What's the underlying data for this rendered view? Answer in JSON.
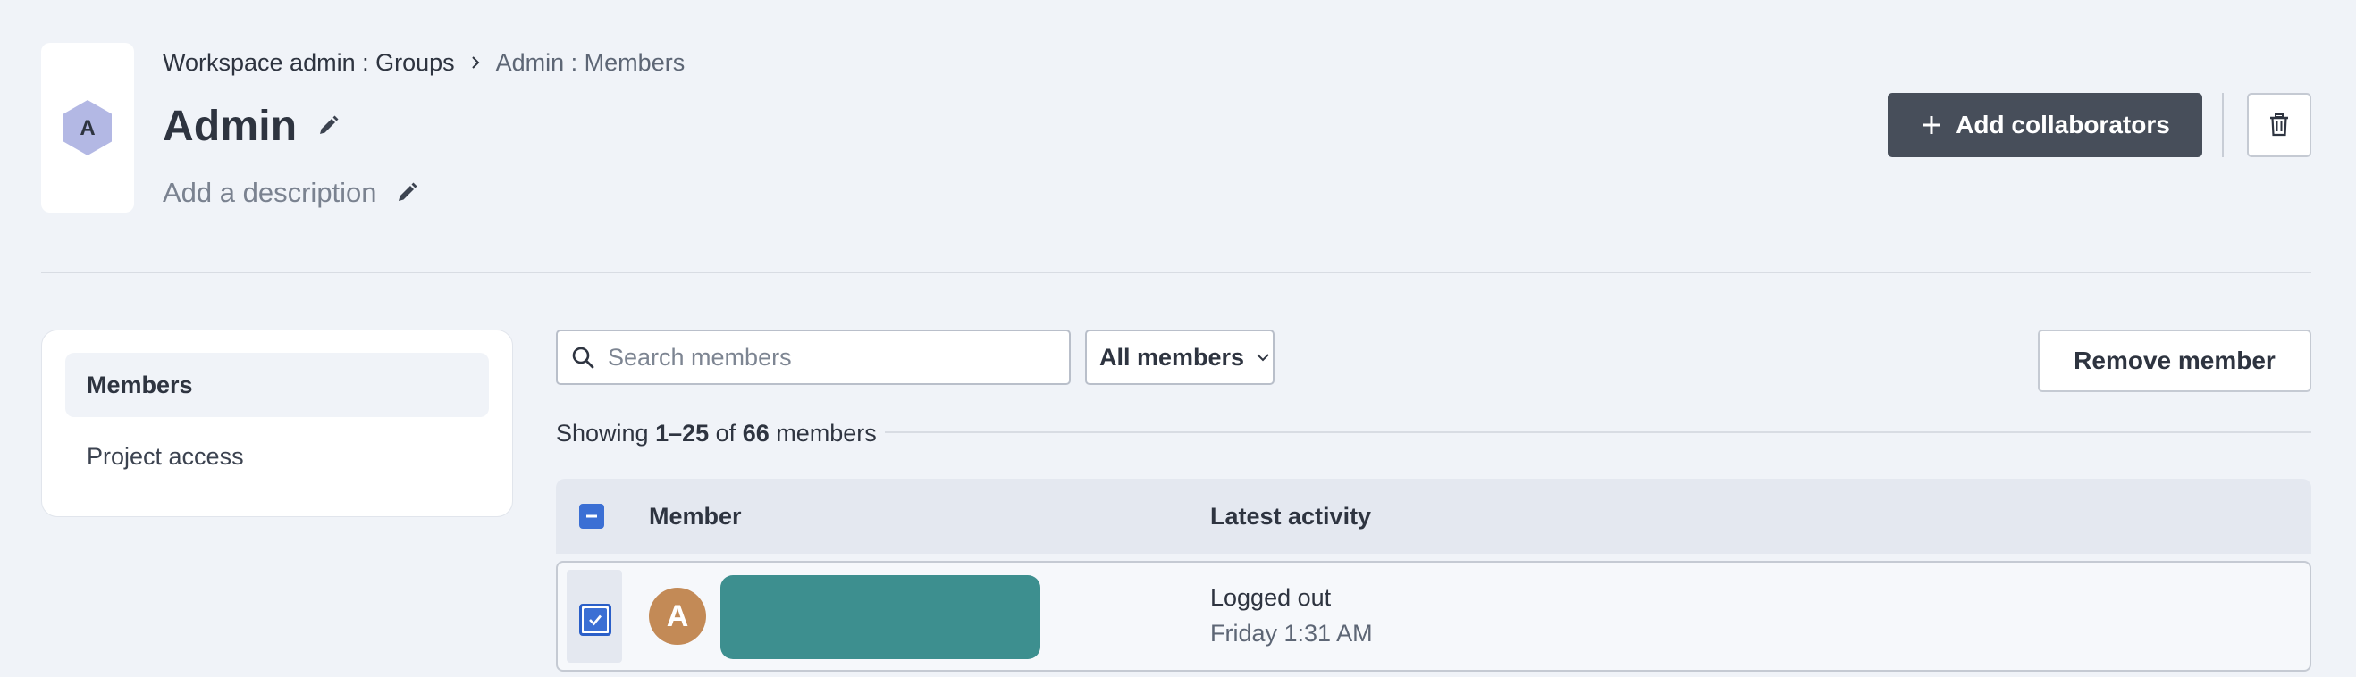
{
  "group": {
    "avatar_letter": "A",
    "title": "Admin",
    "description_placeholder": "Add a description"
  },
  "breadcrumb": {
    "parent": "Workspace admin : Groups",
    "current": "Admin : Members"
  },
  "actions": {
    "add_collaborators_label": "Add collaborators",
    "remove_member_label": "Remove member"
  },
  "sidebar": {
    "items": [
      {
        "label": "Members",
        "active": true
      },
      {
        "label": "Project access",
        "active": false
      }
    ]
  },
  "toolbar": {
    "search_placeholder": "Search members",
    "filter_value": "All members"
  },
  "pagination": {
    "prefix": "Showing ",
    "range": "1–25",
    "middle": " of ",
    "total": "66",
    "suffix": " members"
  },
  "table": {
    "columns": [
      "Member",
      "Latest activity"
    ],
    "rows": [
      {
        "avatar_letter": "A",
        "activity_status": "Logged out",
        "activity_time": "Friday 1:31 AM",
        "selected": true
      }
    ]
  },
  "colors": {
    "primary_button": "#474e5a",
    "checkbox_accent": "#3b6fd4",
    "avatar": "#c38a56",
    "redaction": "#3d8f8f",
    "group_hex": "#b3b8e4"
  },
  "icons": {
    "group_avatar": "hexagon-icon",
    "breadcrumb_separator": "chevron-right-icon",
    "edit_title": "pencil-icon",
    "edit_description": "pencil-icon",
    "add": "plus-icon",
    "delete": "trash-icon",
    "search": "search-icon",
    "filter": "chevron-down-icon",
    "select_all": "indeterminate-checkbox-icon",
    "row_select": "checkmark-icon"
  }
}
